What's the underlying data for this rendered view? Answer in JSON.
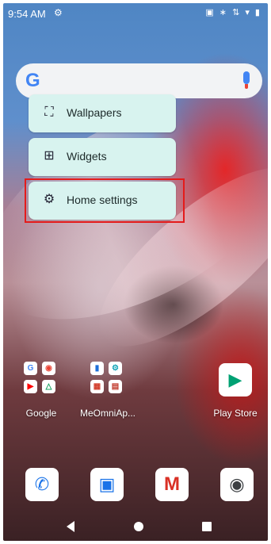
{
  "status_bar": {
    "time": "9:54 AM",
    "settings_glyph": "⚙",
    "right_icons": "▣ ∗ ⇅ ▾ ▮"
  },
  "search_bar": {
    "google_letter": "G",
    "mic_icon": "mic-icon"
  },
  "context_menu": {
    "items": [
      {
        "label": "Wallpapers",
        "glyph": "⛶"
      },
      {
        "label": "Widgets",
        "glyph": "⊞"
      },
      {
        "label": "Home settings",
        "glyph": "⚙"
      }
    ],
    "highlight_color": "#e41b1b"
  },
  "apps": {
    "google_folder": {
      "label": "Google",
      "cells": [
        "G",
        "◉",
        "▶",
        "△"
      ]
    },
    "meomni_folder": {
      "label": "MeOmniAp...",
      "cells": [
        "▮",
        "⚙",
        "▦",
        "▤"
      ]
    },
    "play_store": {
      "label": "Play Store",
      "glyph": "▶"
    }
  },
  "dock": {
    "phone": "✆",
    "contacts": "▣",
    "gmail": "M",
    "camera": "◉"
  }
}
